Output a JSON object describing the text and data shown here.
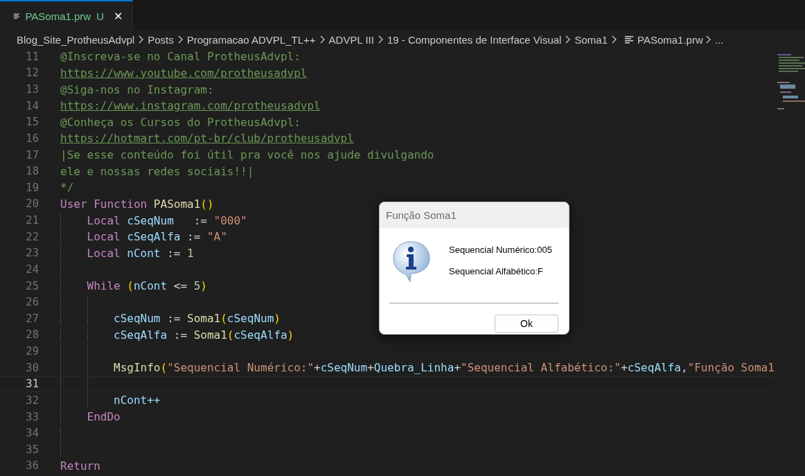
{
  "tab": {
    "label": "PASoma1.prw",
    "status": "U",
    "close": "✕",
    "selected": true
  },
  "breadcrumb": [
    {
      "label": "Blog_Site_ProtheusAdvpl",
      "kind": "folder"
    },
    {
      "label": "Posts",
      "kind": "folder"
    },
    {
      "label": "Programacao ADVPL_TL++",
      "kind": "folder"
    },
    {
      "label": "ADVPL III",
      "kind": "folder"
    },
    {
      "label": "19 - Componentes de Interface Visual",
      "kind": "folder"
    },
    {
      "label": "Soma1",
      "kind": "folder"
    },
    {
      "label": "PASoma1.prw",
      "kind": "file"
    },
    {
      "label": "...",
      "kind": "more"
    }
  ],
  "code_lines": [
    {
      "number": "11",
      "current": false,
      "tokens": [
        {
          "t": "@Inscreva-se no Canal ProtheusAdvpl:",
          "color": "#6a9955"
        }
      ]
    },
    {
      "number": "12",
      "current": false,
      "tokens": [
        {
          "t": "https://www.youtube.com/protheusadvpl",
          "color": "#6a9955",
          "link": true
        }
      ]
    },
    {
      "number": "13",
      "current": false,
      "tokens": [
        {
          "t": "@Siga-nos no Instagram:",
          "color": "#6a9955"
        }
      ]
    },
    {
      "number": "14",
      "current": false,
      "tokens": [
        {
          "t": "https://www.instagram.com/protheusadvpl",
          "color": "#6a9955",
          "link": true
        }
      ]
    },
    {
      "number": "15",
      "current": false,
      "tokens": [
        {
          "t": "@Conheça os Cursos do ProtheusAdvpl:",
          "color": "#6a9955"
        }
      ]
    },
    {
      "number": "16",
      "current": false,
      "tokens": [
        {
          "t": "https://hotmart.com/pt-br/club/protheusadvpl",
          "color": "#6a9955",
          "link": true
        }
      ]
    },
    {
      "number": "17",
      "current": false,
      "tokens": [
        {
          "t": "|Se esse conteúdo foi útil pra você nos ajude divulgando",
          "color": "#6a9955"
        }
      ]
    },
    {
      "number": "18",
      "current": false,
      "tokens": [
        {
          "t": "ele e nossas redes sociais!!|",
          "color": "#6a9955"
        }
      ]
    },
    {
      "number": "19",
      "current": false,
      "tokens": [
        {
          "t": "*/",
          "color": "#6a9955"
        }
      ]
    },
    {
      "number": "20",
      "current": false,
      "tokens": [
        {
          "t": "User Function ",
          "color": "#c586c0"
        },
        {
          "t": "PASoma1",
          "color": "#dcdcaa"
        },
        {
          "t": "()",
          "color": "#ffd700"
        }
      ]
    },
    {
      "number": "21",
      "current": false,
      "tokens": [
        {
          "t": "    Local ",
          "color": "#c586c0"
        },
        {
          "t": "cSeqNum",
          "color": "#9cdcfe"
        },
        {
          "t": "   := ",
          "color": "#d4d4d4"
        },
        {
          "t": "\"000\"",
          "color": "#ce9178"
        }
      ]
    },
    {
      "number": "22",
      "current": false,
      "tokens": [
        {
          "t": "    Local ",
          "color": "#c586c0"
        },
        {
          "t": "cSeqAlfa",
          "color": "#9cdcfe"
        },
        {
          "t": " := ",
          "color": "#d4d4d4"
        },
        {
          "t": "\"A\"",
          "color": "#ce9178"
        }
      ]
    },
    {
      "number": "23",
      "current": false,
      "tokens": [
        {
          "t": "    Local ",
          "color": "#c586c0"
        },
        {
          "t": "nCont",
          "color": "#9cdcfe"
        },
        {
          "t": " := ",
          "color": "#d4d4d4"
        },
        {
          "t": "1",
          "color": "#b5cea8"
        }
      ]
    },
    {
      "number": "24",
      "current": false
    },
    {
      "number": "25",
      "current": false,
      "tokens": [
        {
          "t": "    While ",
          "color": "#c586c0"
        },
        {
          "t": "(",
          "color": "#ffd700"
        },
        {
          "t": "nCont",
          "color": "#9cdcfe"
        },
        {
          "t": " <= ",
          "color": "#d4d4d4"
        },
        {
          "t": "5",
          "color": "#b5cea8"
        },
        {
          "t": ")",
          "color": "#ffd700"
        }
      ]
    },
    {
      "number": "26",
      "current": false
    },
    {
      "number": "27",
      "current": false,
      "tokens": [
        {
          "t": "        cSeqNum",
          "color": "#9cdcfe"
        },
        {
          "t": " := ",
          "color": "#d4d4d4"
        },
        {
          "t": "Soma1",
          "color": "#dcdcaa"
        },
        {
          "t": "(",
          "color": "#ffd700"
        },
        {
          "t": "cSeqNum",
          "color": "#9cdcfe"
        },
        {
          "t": ")",
          "color": "#ffd700"
        }
      ]
    },
    {
      "number": "28",
      "current": false,
      "tokens": [
        {
          "t": "        cSeqAlfa",
          "color": "#9cdcfe"
        },
        {
          "t": " := ",
          "color": "#d4d4d4"
        },
        {
          "t": "Soma1",
          "color": "#dcdcaa"
        },
        {
          "t": "(",
          "color": "#ffd700"
        },
        {
          "t": "cSeqAlfa",
          "color": "#9cdcfe"
        },
        {
          "t": ")",
          "color": "#ffd700"
        }
      ]
    },
    {
      "number": "29",
      "current": false
    },
    {
      "number": "30",
      "current": false,
      "tokens": [
        {
          "t": "        MsgInfo",
          "color": "#dcdcaa"
        },
        {
          "t": "(",
          "color": "#ffd700"
        },
        {
          "t": "\"Sequencial Numérico:\"",
          "color": "#ce9178"
        },
        {
          "t": "+",
          "color": "#d4d4d4"
        },
        {
          "t": "cSeqNum",
          "color": "#9cdcfe"
        },
        {
          "t": "+",
          "color": "#d4d4d4"
        },
        {
          "t": "Quebra_Linha",
          "color": "#9cdcfe"
        },
        {
          "t": "+",
          "color": "#d4d4d4"
        },
        {
          "t": "\"Sequencial Alfabético:\"",
          "color": "#ce9178"
        },
        {
          "t": "+",
          "color": "#d4d4d4"
        },
        {
          "t": "cSeqAlfa",
          "color": "#9cdcfe"
        },
        {
          "t": ",",
          "color": "#d4d4d4"
        },
        {
          "t": "\"Função Soma1",
          "color": "#ce9178"
        }
      ]
    },
    {
      "number": "31",
      "current": true
    },
    {
      "number": "32",
      "current": false,
      "tokens": [
        {
          "t": "        nCont++",
          "color": "#9cdcfe"
        }
      ]
    },
    {
      "number": "33",
      "current": false,
      "tokens": [
        {
          "t": "    EndDo",
          "color": "#c586c0"
        }
      ]
    },
    {
      "number": "34",
      "current": false
    },
    {
      "number": "35",
      "current": false
    },
    {
      "number": "36",
      "current": false,
      "tokens": [
        {
          "t": "Return",
          "color": "#c586c0"
        }
      ]
    }
  ],
  "dialog": {
    "title": "Função Soma1",
    "messages": [
      "Sequencial Numérico:005",
      "Sequencial Alfabético:F"
    ],
    "button": "Ok"
  }
}
